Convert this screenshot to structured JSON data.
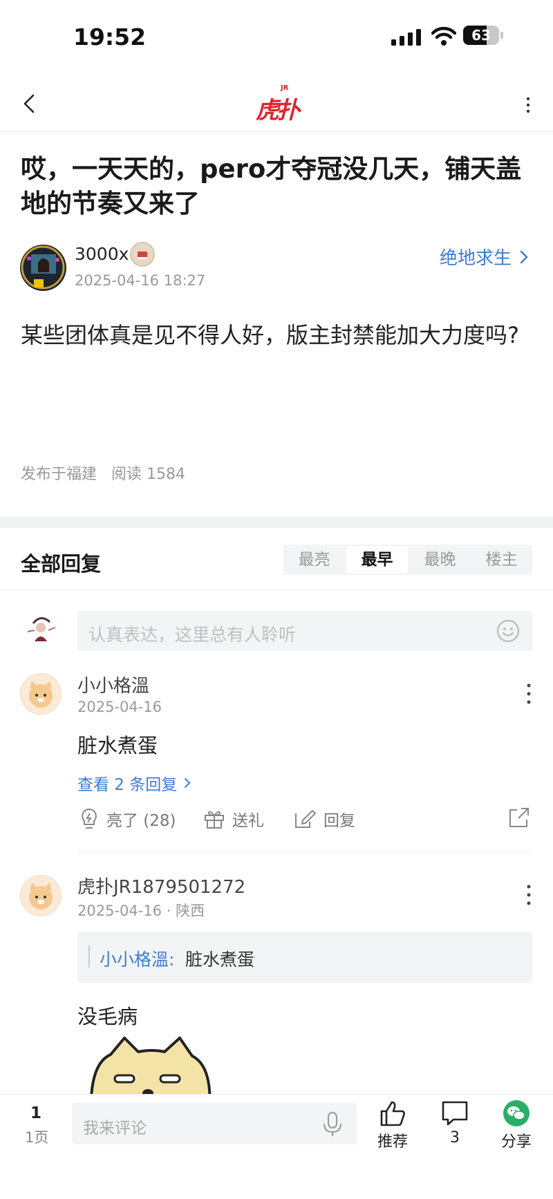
{
  "status": {
    "time": "19:52",
    "battery": "63"
  },
  "nav": {
    "logo_text": "虎扑",
    "logo_badge": "JR"
  },
  "post": {
    "title": "哎，一天天的，pero才夺冠没几天，铺天盖地的节奏又来了",
    "author": "3000x",
    "time": "2025-04-16 18:27",
    "forum": "绝地求生",
    "body": "某些团体真是见不得人好，版主封禁能加大力度吗?",
    "location": "发布于福建",
    "reads": "阅读 1584"
  },
  "replies_header": {
    "title": "全部回复",
    "sort_tabs": [
      "最亮",
      "最早",
      "最晚",
      "楼主"
    ],
    "active_tab": "最早"
  },
  "comment_input": {
    "placeholder": "认真表达，这里总有人聆听"
  },
  "replies": [
    {
      "name": "小小格溫",
      "time": "2025-04-16",
      "text": "脏水煮蛋",
      "view_replies": "查看 2 条回复",
      "actions": {
        "like": "亮了 (28)",
        "gift": "送礼",
        "reply": "回复"
      }
    },
    {
      "name": "虎扑JR1879501272",
      "time": "2025-04-16 · 陕西",
      "quote_name": "小小格溫:",
      "quote_text": "脏水煮蛋",
      "text": "没毛病"
    }
  ],
  "bottom_bar": {
    "page_num": "1",
    "page_label": "1页",
    "placeholder": "我来评论",
    "recommend": "推荐",
    "comments": "3",
    "share": "分享"
  },
  "colors": {
    "link": "#3e7bd6",
    "brand": "#e0242b",
    "wechat": "#2aae67"
  }
}
